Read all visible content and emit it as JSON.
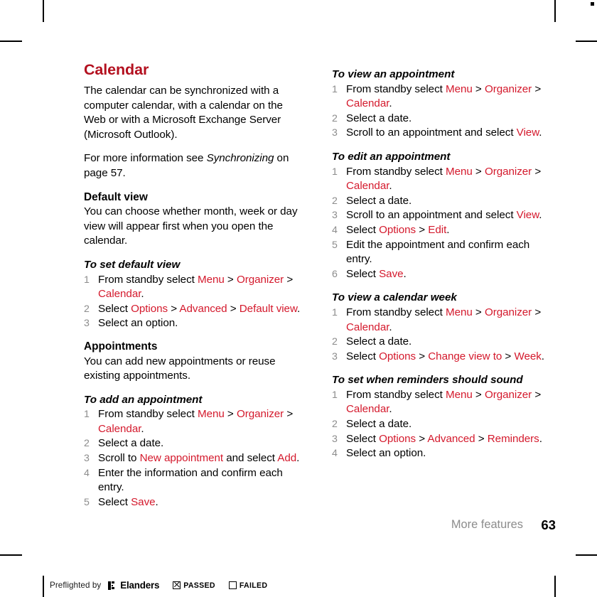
{
  "footer": {
    "section_title": "More features",
    "page_number": "63"
  },
  "preflight": {
    "prefix": "Preflighted by",
    "brand": "Elanders",
    "passed_label": "PASSED",
    "failed_label": "FAILED",
    "passed_checked": true,
    "failed_checked": false
  },
  "colors": {
    "heading_red": "#b3101f",
    "link_red": "#d4192c",
    "number_gray": "#8c8c8c",
    "footer_gray": "#8c8c8c"
  },
  "left_column": {
    "chapter_title": "Calendar",
    "intro_paragraph": "The calendar can be synchronized with a computer calendar, with a calendar on the Web or with a Microsoft Exchange Server (Microsoft Outlook).",
    "reference_paragraph": {
      "before": "For more information see ",
      "italic": "Synchronizing",
      "after": " on page 57."
    },
    "default_view": {
      "heading": "Default view",
      "text": "You can choose whether month, week or day view will appear first when you open the calendar."
    },
    "task_set_default_view": {
      "heading": "To set default view",
      "steps": [
        {
          "num": "1",
          "parts": [
            {
              "t": "From standby select ",
              "style": "plain"
            },
            {
              "t": "Menu",
              "style": "link"
            },
            {
              "t": " > ",
              "style": "plain"
            },
            {
              "t": "Organizer",
              "style": "link"
            },
            {
              "t": " > ",
              "style": "plain"
            },
            {
              "t": "Calendar",
              "style": "link"
            },
            {
              "t": ".",
              "style": "plain"
            }
          ]
        },
        {
          "num": "2",
          "parts": [
            {
              "t": "Select ",
              "style": "plain"
            },
            {
              "t": "Options",
              "style": "link"
            },
            {
              "t": " > ",
              "style": "plain"
            },
            {
              "t": "Advanced",
              "style": "link"
            },
            {
              "t": " > ",
              "style": "plain"
            },
            {
              "t": "Default view",
              "style": "link"
            },
            {
              "t": ".",
              "style": "plain"
            }
          ]
        },
        {
          "num": "3",
          "parts": [
            {
              "t": "Select an option.",
              "style": "plain"
            }
          ]
        }
      ]
    },
    "appointments": {
      "heading": "Appointments",
      "text": "You can add new appointments or reuse existing appointments."
    },
    "task_add_appointment": {
      "heading": "To add an appointment",
      "steps": [
        {
          "num": "1",
          "parts": [
            {
              "t": "From standby select ",
              "style": "plain"
            },
            {
              "t": "Menu",
              "style": "link"
            },
            {
              "t": " > ",
              "style": "plain"
            },
            {
              "t": "Organizer",
              "style": "link"
            },
            {
              "t": " > ",
              "style": "plain"
            },
            {
              "t": "Calendar",
              "style": "link"
            },
            {
              "t": ".",
              "style": "plain"
            }
          ]
        },
        {
          "num": "2",
          "parts": [
            {
              "t": "Select a date.",
              "style": "plain"
            }
          ]
        },
        {
          "num": "3",
          "parts": [
            {
              "t": "Scroll to ",
              "style": "plain"
            },
            {
              "t": "New appointment",
              "style": "link"
            },
            {
              "t": " and select ",
              "style": "plain"
            },
            {
              "t": "Add",
              "style": "link"
            },
            {
              "t": ".",
              "style": "plain"
            }
          ]
        },
        {
          "num": "4",
          "parts": [
            {
              "t": "Enter the information and confirm each entry.",
              "style": "plain"
            }
          ]
        },
        {
          "num": "5",
          "parts": [
            {
              "t": "Select ",
              "style": "plain"
            },
            {
              "t": "Save",
              "style": "link"
            },
            {
              "t": ".",
              "style": "plain"
            }
          ]
        }
      ]
    }
  },
  "right_column": {
    "task_view_appointment": {
      "heading": "To view an appointment",
      "steps": [
        {
          "num": "1",
          "parts": [
            {
              "t": "From standby select ",
              "style": "plain"
            },
            {
              "t": "Menu",
              "style": "link"
            },
            {
              "t": " > ",
              "style": "plain"
            },
            {
              "t": "Organizer",
              "style": "link"
            },
            {
              "t": " > ",
              "style": "plain"
            },
            {
              "t": "Calendar",
              "style": "link"
            },
            {
              "t": ".",
              "style": "plain"
            }
          ]
        },
        {
          "num": "2",
          "parts": [
            {
              "t": "Select a date.",
              "style": "plain"
            }
          ]
        },
        {
          "num": "3",
          "parts": [
            {
              "t": "Scroll to an appointment and select ",
              "style": "plain"
            },
            {
              "t": "View",
              "style": "link"
            },
            {
              "t": ".",
              "style": "plain"
            }
          ]
        }
      ]
    },
    "task_edit_appointment": {
      "heading": "To edit an appointment",
      "steps": [
        {
          "num": "1",
          "parts": [
            {
              "t": "From standby select ",
              "style": "plain"
            },
            {
              "t": "Menu",
              "style": "link"
            },
            {
              "t": " > ",
              "style": "plain"
            },
            {
              "t": "Organizer",
              "style": "link"
            },
            {
              "t": " > ",
              "style": "plain"
            },
            {
              "t": "Calendar",
              "style": "link"
            },
            {
              "t": ".",
              "style": "plain"
            }
          ]
        },
        {
          "num": "2",
          "parts": [
            {
              "t": "Select a date.",
              "style": "plain"
            }
          ]
        },
        {
          "num": "3",
          "parts": [
            {
              "t": "Scroll to an appointment and select ",
              "style": "plain"
            },
            {
              "t": "View",
              "style": "link"
            },
            {
              "t": ".",
              "style": "plain"
            }
          ]
        },
        {
          "num": "4",
          "parts": [
            {
              "t": "Select ",
              "style": "plain"
            },
            {
              "t": "Options",
              "style": "link"
            },
            {
              "t": " > ",
              "style": "plain"
            },
            {
              "t": "Edit",
              "style": "link"
            },
            {
              "t": ".",
              "style": "plain"
            }
          ]
        },
        {
          "num": "5",
          "parts": [
            {
              "t": "Edit the appointment and confirm each entry.",
              "style": "plain"
            }
          ]
        },
        {
          "num": "6",
          "parts": [
            {
              "t": "Select ",
              "style": "plain"
            },
            {
              "t": "Save",
              "style": "link"
            },
            {
              "t": ".",
              "style": "plain"
            }
          ]
        }
      ]
    },
    "task_view_calendar_week": {
      "heading": "To view a calendar week",
      "steps": [
        {
          "num": "1",
          "parts": [
            {
              "t": "From standby select ",
              "style": "plain"
            },
            {
              "t": "Menu",
              "style": "link"
            },
            {
              "t": " > ",
              "style": "plain"
            },
            {
              "t": "Organizer",
              "style": "link"
            },
            {
              "t": " > ",
              "style": "plain"
            },
            {
              "t": "Calendar",
              "style": "link"
            },
            {
              "t": ".",
              "style": "plain"
            }
          ]
        },
        {
          "num": "2",
          "parts": [
            {
              "t": "Select a date.",
              "style": "plain"
            }
          ]
        },
        {
          "num": "3",
          "parts": [
            {
              "t": "Select ",
              "style": "plain"
            },
            {
              "t": "Options",
              "style": "link"
            },
            {
              "t": " > ",
              "style": "plain"
            },
            {
              "t": "Change view to",
              "style": "link"
            },
            {
              "t": " > ",
              "style": "plain"
            },
            {
              "t": "Week",
              "style": "link"
            },
            {
              "t": ".",
              "style": "plain"
            }
          ]
        }
      ]
    },
    "task_set_reminders": {
      "heading": "To set when reminders should sound",
      "steps": [
        {
          "num": "1",
          "parts": [
            {
              "t": "From standby select ",
              "style": "plain"
            },
            {
              "t": "Menu",
              "style": "link"
            },
            {
              "t": " > ",
              "style": "plain"
            },
            {
              "t": "Organizer",
              "style": "link"
            },
            {
              "t": " > ",
              "style": "plain"
            },
            {
              "t": "Calendar",
              "style": "link"
            },
            {
              "t": ".",
              "style": "plain"
            }
          ]
        },
        {
          "num": "2",
          "parts": [
            {
              "t": "Select a date.",
              "style": "plain"
            }
          ]
        },
        {
          "num": "3",
          "parts": [
            {
              "t": "Select ",
              "style": "plain"
            },
            {
              "t": "Options",
              "style": "link"
            },
            {
              "t": " > ",
              "style": "plain"
            },
            {
              "t": "Advanced",
              "style": "link"
            },
            {
              "t": " > ",
              "style": "plain"
            },
            {
              "t": "Reminders",
              "style": "link"
            },
            {
              "t": ".",
              "style": "plain"
            }
          ]
        },
        {
          "num": "4",
          "parts": [
            {
              "t": "Select an option.",
              "style": "plain"
            }
          ]
        }
      ]
    }
  }
}
